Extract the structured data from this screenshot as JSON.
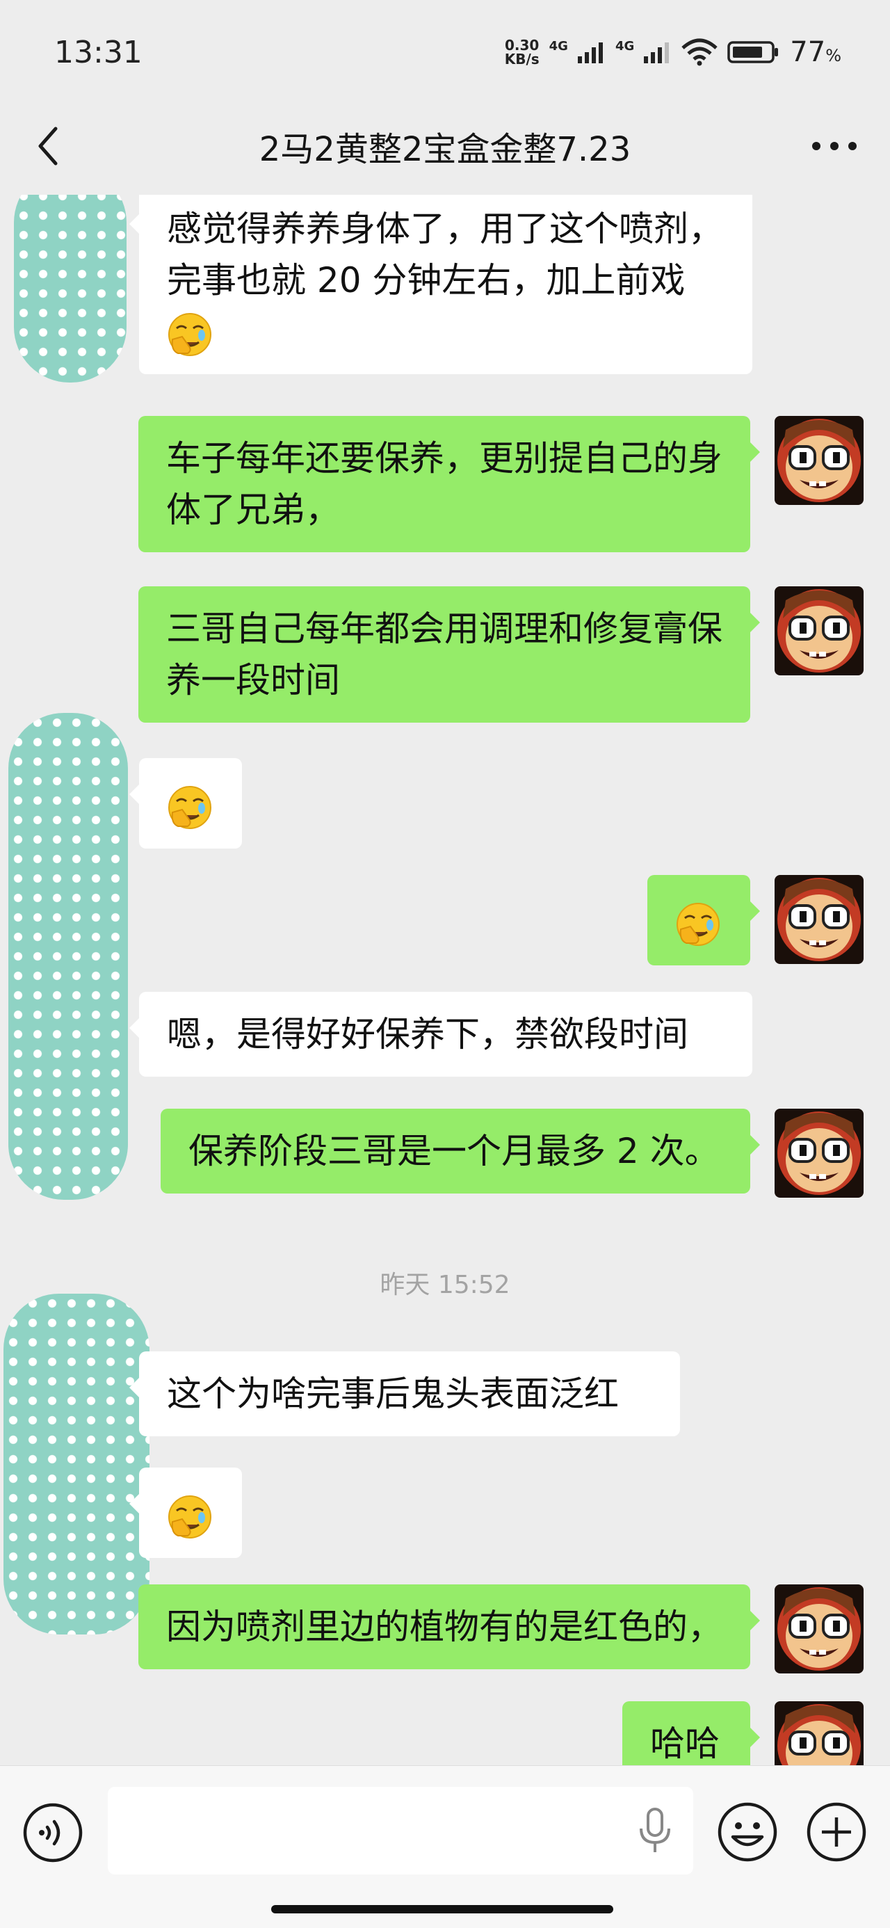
{
  "status": {
    "time": "13:31",
    "speed_value": "0.30",
    "speed_unit": "KB/s",
    "net1": "4G",
    "net2": "4G",
    "battery_pct": "77",
    "battery_unit": "%"
  },
  "header": {
    "title": "2马2黄整2宝盒金整7.23",
    "back_icon": "chevron-left-icon",
    "more_icon": "more-dots-icon"
  },
  "messages": [
    {
      "side": "in",
      "text": "感觉得养养身体了，用了这个喷剂，完事也就 20 分钟左右，加上前戏",
      "emoji_after": "facepalm-emoji"
    },
    {
      "side": "out",
      "text": "车子每年还要保养，更别提自己的身体了兄弟，"
    },
    {
      "side": "out",
      "text": "三哥自己每年都会用调理和修复膏保养一段时间"
    },
    {
      "side": "in",
      "emoji": "facepalm-emoji"
    },
    {
      "side": "out",
      "emoji": "facepalm-emoji"
    },
    {
      "side": "in",
      "text": "嗯，是得好好保养下，禁欲段时间"
    },
    {
      "side": "out",
      "text": "保养阶段三哥是一个月最多 2 次。"
    },
    {
      "timestamp": "昨天 15:52"
    },
    {
      "side": "in",
      "text": "这个为啥完事后鬼头表面泛红"
    },
    {
      "side": "in",
      "emoji": "facepalm-emoji"
    },
    {
      "side": "out",
      "text": "因为喷剂里边的植物有的是红色的，"
    },
    {
      "side": "out",
      "text": "哈哈"
    }
  ],
  "input": {
    "value": "",
    "voice_icon": "voice-icon",
    "mic_icon": "mic-icon",
    "emoji_icon": "emoji-icon",
    "plus_icon": "plus-icon"
  },
  "colors": {
    "background": "#ededed",
    "outgoing_bubble": "#95ec69",
    "incoming_bubble": "#ffffff",
    "timestamp": "#a3a3a3"
  }
}
